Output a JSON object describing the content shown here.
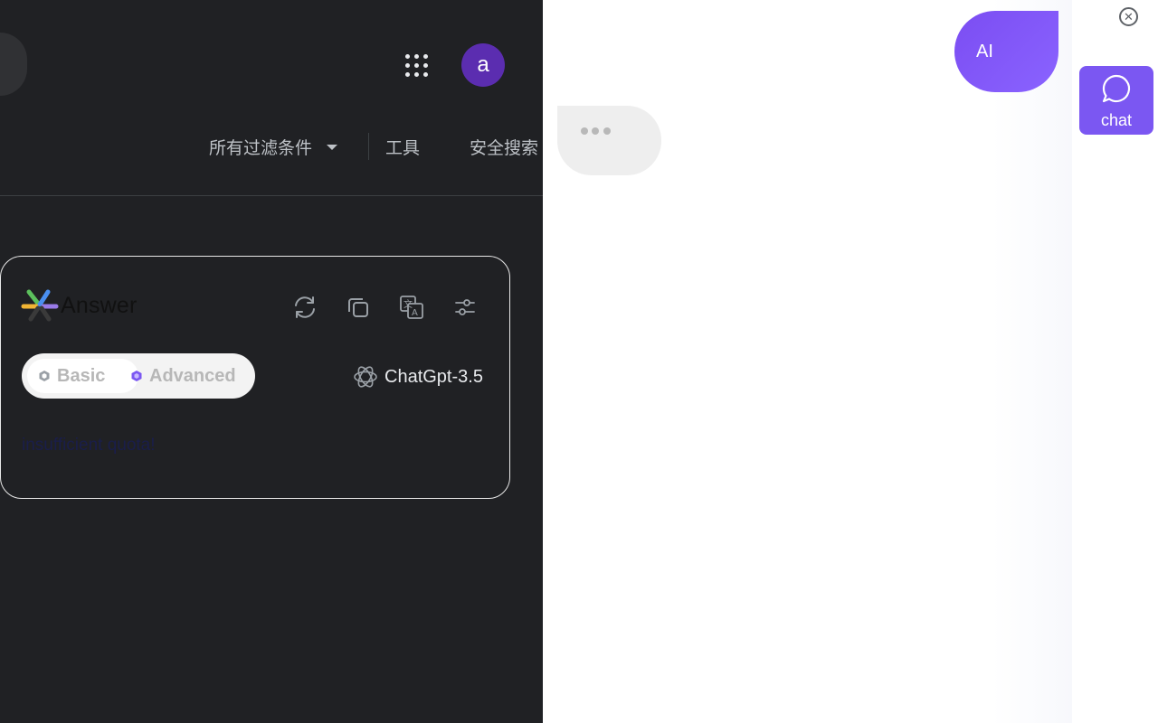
{
  "google": {
    "avatar_letter": "a",
    "filters": {
      "all_filters": "所有过滤条件",
      "tools": "工具",
      "safe_search": "安全搜索"
    }
  },
  "answer_card": {
    "logo_text": "Answer",
    "tools": [
      "refresh-icon",
      "copy-icon",
      "translate-icon",
      "settings-sliders-icon"
    ],
    "mode_basic": "Basic",
    "mode_advanced": "Advanced",
    "active_mode": "Basic",
    "model": "ChatGpt-3.5",
    "response_text": "insufficient quota!"
  },
  "chat_panel": {
    "ai_bubble_label": "AI",
    "chat_button_label": "chat",
    "close_icon": "close-circle-icon",
    "accent_color": "#7b57f2"
  }
}
